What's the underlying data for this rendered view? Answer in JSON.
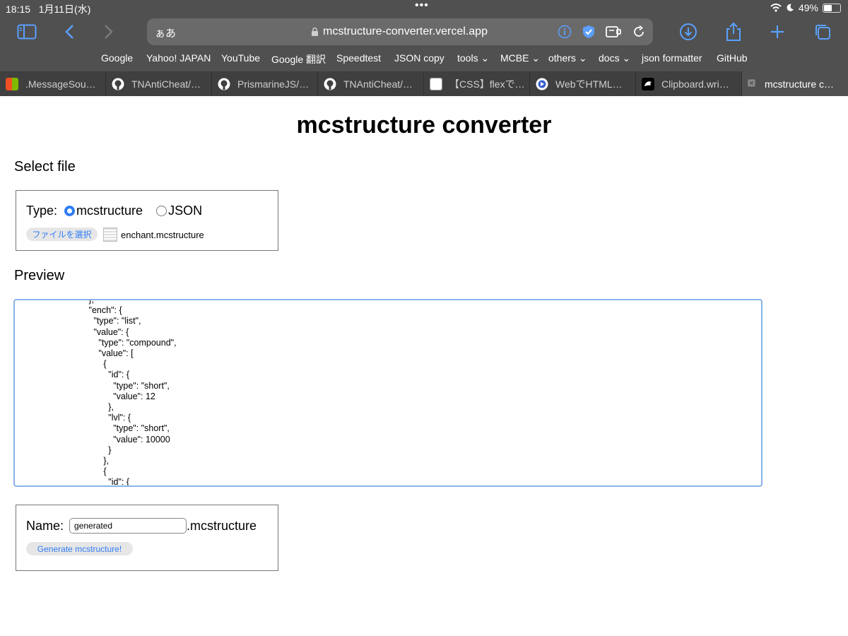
{
  "status": {
    "time": "18:15",
    "date": "1月11日(水)",
    "battery": "49%",
    "battery_level": 0.49
  },
  "browser": {
    "ime_indicator": "ぁあ",
    "url": "mcstructure-converter.vercel.app",
    "bookmarks": [
      "Google",
      "Yahoo! JAPAN",
      "YouTube",
      "Google 翻訳",
      "Speedtest",
      "JSON copy",
      "tools",
      "MCBE",
      "others",
      "docs",
      "json formatter",
      "GitHub"
    ],
    "tabs": [
      {
        "label": ".MessageSou…",
        "icon": "microsoft-icon"
      },
      {
        "label": "TNAntiCheat/…",
        "icon": "github-icon"
      },
      {
        "label": "PrismarineJS/…",
        "icon": "github-icon"
      },
      {
        "label": "TNAntiCheat/…",
        "icon": "github-icon"
      },
      {
        "label": "【CSS】flexで…",
        "icon": "qiita-icon"
      },
      {
        "label": "WebでHTML…",
        "icon": "web-icon"
      },
      {
        "label": "Clipboard.wri…",
        "icon": "mdn-icon"
      },
      {
        "label": "mcstructure c…",
        "icon": "close-icon",
        "active": true
      }
    ],
    "accent_color": "#5aa0ff"
  },
  "page": {
    "title": "mcstructure converter",
    "select_heading": "Select file",
    "type_label": "Type:",
    "type_options": [
      "mcstructure",
      "JSON"
    ],
    "type_selected": "mcstructure",
    "file_button": "ファイルを選択",
    "file_name": "enchant.mcstructure",
    "preview_heading": "Preview",
    "preview_text": "                  },\n                  \"ench\": {\n                    \"type\": \"list\",\n                    \"value\": {\n                      \"type\": \"compound\",\n                      \"value\": [\n                        {\n                          \"id\": {\n                            \"type\": \"short\",\n                            \"value\": 12\n                          },\n                          \"lvl\": {\n                            \"type\": \"short\",\n                            \"value\": 10000\n                          }\n                        },\n                        {\n                          \"id\": {",
    "name_label": "Name:",
    "name_value": "generated",
    "name_suffix": ".mcstructure",
    "generate_button": "Generate mcstructure!"
  }
}
